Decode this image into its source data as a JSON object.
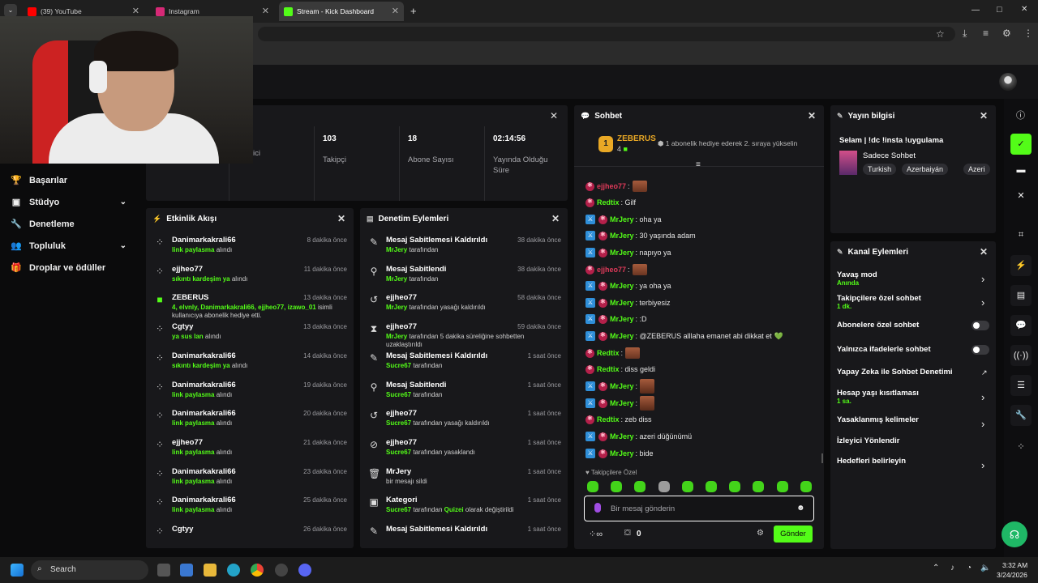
{
  "browser": {
    "tabs": [
      {
        "label": "(39) YouTube",
        "color": "#ff0000"
      },
      {
        "label": "Instagram",
        "color": "#d62976"
      },
      {
        "label": "Stream - Kick Dashboard",
        "color": "#53fc18"
      }
    ],
    "new_tab": "+",
    "window_controls": [
      "—",
      "□",
      "✕"
    ]
  },
  "sidebar": {
    "items": [
      {
        "label": "Başarılar",
        "icon": "trophy-icon"
      },
      {
        "label": "Stüdyo",
        "icon": "studio-icon"
      },
      {
        "label": "Denetleme",
        "icon": "wrench-icon"
      },
      {
        "label": "Topluluk",
        "icon": "community-icon"
      },
      {
        "label": "Droplar ve ödüller",
        "icon": "gift-icon"
      }
    ]
  },
  "stats": {
    "partial_left": "izleyici",
    "followers_value": "103",
    "followers_label": "Takipçi",
    "subs_value": "18",
    "subs_label": "Abone Sayısı",
    "uptime_value": "02:14:56",
    "uptime_label": "Yayında Olduğu Süre"
  },
  "activity": {
    "title": "Etkinlik Akışı",
    "items": [
      {
        "name": "Danimarkakrali66",
        "time": "8 dakika önce",
        "action": "link paylasma",
        "suffix": " alındı"
      },
      {
        "name": "ejjheo77",
        "time": "11 dakika önce",
        "action": "sıkıntı kardeşim ya",
        "suffix": " alındı"
      },
      {
        "name": "ZEBERUS",
        "time": "13 dakika önce",
        "action": "4, elvnly, Danimarkakrali66, ejjheo77, izawo_01",
        "suffix": " isimli kullanıcıya abonelik hediye etti."
      },
      {
        "name": "Cgtyy",
        "time": "13 dakika önce",
        "action": "ya sus lan",
        "suffix": " alındı"
      },
      {
        "name": "Danimarkakrali66",
        "time": "14 dakika önce",
        "action": "sıkıntı kardeşim ya",
        "suffix": " alındı"
      },
      {
        "name": "Danimarkakrali66",
        "time": "19 dakika önce",
        "action": "link paylasma",
        "suffix": " alındı"
      },
      {
        "name": "Danimarkakrali66",
        "time": "20 dakika önce",
        "action": "link paylasma",
        "suffix": " alındı"
      },
      {
        "name": "ejjheo77",
        "time": "21 dakika önce",
        "action": "link paylasma",
        "suffix": " alındı"
      },
      {
        "name": "Danimarkakrali66",
        "time": "23 dakika önce",
        "action": "link paylasma",
        "suffix": " alındı"
      },
      {
        "name": "Danimarkakrali66",
        "time": "25 dakika önce",
        "action": "link paylasma",
        "suffix": " alındı"
      },
      {
        "name": "Cgtyy",
        "time": "26 dakika önce",
        "action": "",
        "suffix": ""
      }
    ]
  },
  "modlog": {
    "title": "Denetim Eylemleri",
    "items": [
      {
        "name": "Mesaj Sabitlemesi Kaldırıldı",
        "time": "38 dakika önce",
        "by": "MrJery",
        "suffix": " tarafından",
        "icon": "unpin-icon"
      },
      {
        "name": "Mesaj Sabitlendi",
        "time": "38 dakika önce",
        "by": "MrJery",
        "suffix": " tarafından",
        "icon": "pin-icon"
      },
      {
        "name": "ejjheo77",
        "time": "58 dakika önce",
        "by": "MrJery",
        "suffix": " tarafından yasağı kaldırıldı",
        "icon": "undo-icon"
      },
      {
        "name": "ejjheo77",
        "time": "59 dakika önce",
        "by": "MrJery",
        "suffix": " tarafından 5 dakika süreliğine sohbetten uzaklaştırıldı",
        "icon": "hourglass-icon"
      },
      {
        "name": "Mesaj Sabitlemesi Kaldırıldı",
        "time": "1 saat önce",
        "by": "Sucre67",
        "suffix": " tarafından",
        "icon": "unpin-icon"
      },
      {
        "name": "Mesaj Sabitlendi",
        "time": "1 saat önce",
        "by": "Sucre67",
        "suffix": " tarafından",
        "icon": "pin-icon"
      },
      {
        "name": "ejjheo77",
        "time": "1 saat önce",
        "by": "Sucre67",
        "suffix": " tarafından yasağı kaldırıldı",
        "icon": "undo-icon"
      },
      {
        "name": "ejjheo77",
        "time": "1 saat önce",
        "by": "Sucre67",
        "suffix": " tarafından yasaklandı",
        "icon": "ban-icon"
      },
      {
        "name": "MrJery",
        "time": "1 saat önce",
        "by": "",
        "suffix": "bir mesajı sildi",
        "icon": "trash-icon"
      },
      {
        "name": "Kategori",
        "time": "1 saat önce",
        "by": "Sucre67",
        "suffix": " tarafından ",
        "extra": "Quizei",
        "suffix2": " olarak değiştirildi",
        "icon": "category-icon"
      },
      {
        "name": "Mesaj Sabitlemesi Kaldırıldı",
        "time": "1 saat önce",
        "by": "",
        "suffix": "",
        "icon": "unpin-icon"
      }
    ]
  },
  "chat": {
    "title": "Sohbet",
    "pinned_user": "ZEBERUS",
    "pinned_rank": "1",
    "pinned_count": "4",
    "pinned_msg": "1 abonelik hediye ederek 2. sıraya yükselin",
    "messages": [
      {
        "user": "ejjheo77",
        "color": "#e03a5a",
        "mod": false,
        "text": ":",
        "emote": true
      },
      {
        "user": "Redtix",
        "color": "#53fc18",
        "mod": false,
        "text": ": Gilf"
      },
      {
        "user": "MrJery",
        "color": "#53fc18",
        "mod": true,
        "text": ": oha ya"
      },
      {
        "user": "MrJery",
        "color": "#53fc18",
        "mod": true,
        "text": ": 30 yaşında adam"
      },
      {
        "user": "MrJery",
        "color": "#53fc18",
        "mod": true,
        "text": ": napıyo ya"
      },
      {
        "user": "ejjheo77",
        "color": "#e03a5a",
        "mod": false,
        "text": ":",
        "emote": true
      },
      {
        "user": "MrJery",
        "color": "#53fc18",
        "mod": true,
        "text": ": ya oha ya"
      },
      {
        "user": "MrJery",
        "color": "#53fc18",
        "mod": true,
        "text": ": terbiyesiz"
      },
      {
        "user": "MrJery",
        "color": "#53fc18",
        "mod": true,
        "text": ": :D"
      },
      {
        "user": "MrJery",
        "color": "#53fc18",
        "mod": true,
        "text": ": @ZEBERUS alllaha emanet abi dikkat et",
        "heart": "💚"
      },
      {
        "user": "Redtix",
        "color": "#53fc18",
        "mod": false,
        "text": ":",
        "emote": true
      },
      {
        "user": "Redtix",
        "color": "#53fc18",
        "mod": false,
        "text": ": diss geldi"
      },
      {
        "user": "MrJery",
        "color": "#53fc18",
        "mod": true,
        "text": ":",
        "emote": true
      },
      {
        "user": "MrJery",
        "color": "#53fc18",
        "mod": true,
        "text": ":",
        "emote": true
      },
      {
        "user": "Redtix",
        "color": "#53fc18",
        "mod": false,
        "text": ": zeb diss"
      },
      {
        "user": "MrJery",
        "color": "#53fc18",
        "mod": true,
        "text": ": azeri düğünümü"
      },
      {
        "user": "MrJery",
        "color": "#53fc18",
        "mod": true,
        "text": ": bide"
      }
    ],
    "followers_only": "Takipçilere Özel",
    "input_placeholder": "Bir mesaj gönderin",
    "points": "0",
    "send": "Gönder"
  },
  "streaminfo": {
    "title": "Yayın bilgisi",
    "stream_title": "Selam | !dc !insta !uygulama",
    "category": "Sadece Sohbet",
    "tags": [
      "Turkish",
      "Azerbaiyán",
      "Azeri"
    ]
  },
  "channel_actions": {
    "title": "Kanal Eylemleri",
    "items": [
      {
        "label": "Yavaş mod",
        "sub": "Anında",
        "kind": "arrow"
      },
      {
        "label": "Takipçilere özel sohbet",
        "sub": "1 dk.",
        "kind": "arrow"
      },
      {
        "label": "Abonelere özel sohbet",
        "sub": "",
        "kind": "toggle"
      },
      {
        "label": "Yalnızca ifadelerle sohbet",
        "sub": "",
        "kind": "toggle"
      },
      {
        "label": "Yapay Zeka ile Sohbet Denetimi",
        "sub": "",
        "kind": "external"
      },
      {
        "label": "Hesap yaşı kısıtlaması",
        "sub": "1 sa.",
        "kind": "arrow"
      },
      {
        "label": "Yasaklanmış kelimeler",
        "sub": "",
        "kind": "arrow"
      },
      {
        "label": "İzleyici Yönlendir",
        "sub": "",
        "kind": "none"
      },
      {
        "label": "Hedefleri belirleyin",
        "sub": "",
        "kind": "arrow"
      }
    ]
  },
  "taskbar": {
    "search": "Search",
    "time": "3:32 AM",
    "date": "3/24/2026"
  },
  "colors": {
    "accent": "#53fc18",
    "panel": "#18181b"
  }
}
